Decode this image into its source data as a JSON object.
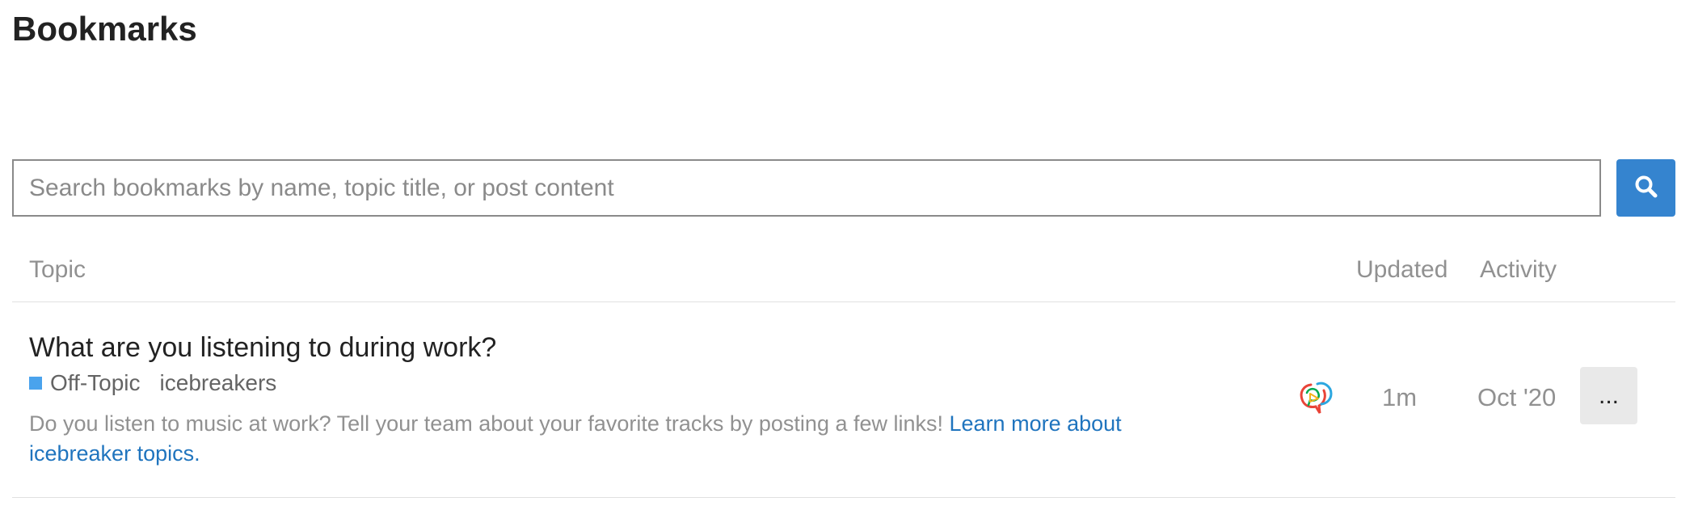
{
  "page": {
    "title": "Bookmarks"
  },
  "search": {
    "placeholder": "Search bookmarks by name, topic title, or post content",
    "value": "",
    "button_icon": "search-icon"
  },
  "table": {
    "columns": {
      "topic": "Topic",
      "updated": "Updated",
      "activity": "Activity"
    },
    "rows": [
      {
        "title": "What are you listening to during work?",
        "category": {
          "name": "Off-Topic",
          "color": "#4aa3ed"
        },
        "tag": "icebreakers",
        "excerpt_text": "Do you listen to music at work? Tell your team about your favorite tracks by posting a few links! ",
        "excerpt_link": "Learn more about icebreaker topics.",
        "avatar_icon": "discourse-logo-icon",
        "updated": "1m",
        "activity": "Oct '20",
        "menu_label": "..."
      }
    ]
  },
  "colors": {
    "primary_button": "#3584cf",
    "link": "#1f74be",
    "muted_text": "#919191",
    "menu_button_bg": "#e9e9e9"
  }
}
